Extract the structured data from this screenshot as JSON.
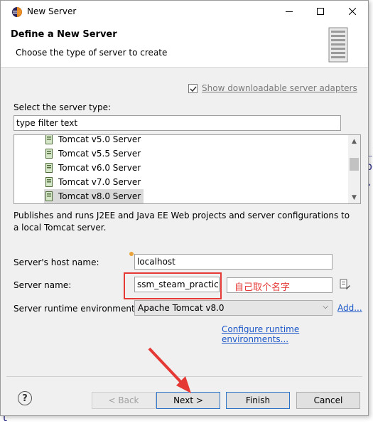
{
  "window": {
    "title": "New Server",
    "minimize_glyph": "—",
    "maximize_glyph": "☐",
    "close_glyph": "✕"
  },
  "banner": {
    "title": "Define a New Server",
    "subtitle": "Choose the type of server to create"
  },
  "downloadable": {
    "checked": true,
    "label": "Show downloadable server adapters"
  },
  "server_type": {
    "label": "Select the server type:",
    "filter_value": "type filter text",
    "items": [
      "Tomcat v5.0 Server",
      "Tomcat v5.5 Server",
      "Tomcat v6.0 Server",
      "Tomcat v7.0 Server",
      "Tomcat v8.0 Server"
    ],
    "selected_index": 4,
    "description": "Publishes and runs J2EE and Java EE Web projects and server configurations to a local Tomcat server."
  },
  "host": {
    "label": "Server's host name:",
    "value": "localhost"
  },
  "server_name": {
    "label": "Server name:",
    "value": "ssm_steam_practice"
  },
  "runtime": {
    "label": "Server runtime environment:",
    "value": "Apache Tomcat v8.0",
    "add_link": "Add...",
    "configure_link": "Configure runtime environments..."
  },
  "buttons": {
    "help": "?",
    "back": "< Back",
    "next": "Next >",
    "finish": "Finish",
    "cancel": "Cancel"
  },
  "annotation": {
    "note": "自己取个名字",
    "color": "#e53935"
  },
  "colors": {
    "link": "#1a56c8",
    "selection": "#d9d9d9",
    "panel": "#f0f0f0"
  }
}
